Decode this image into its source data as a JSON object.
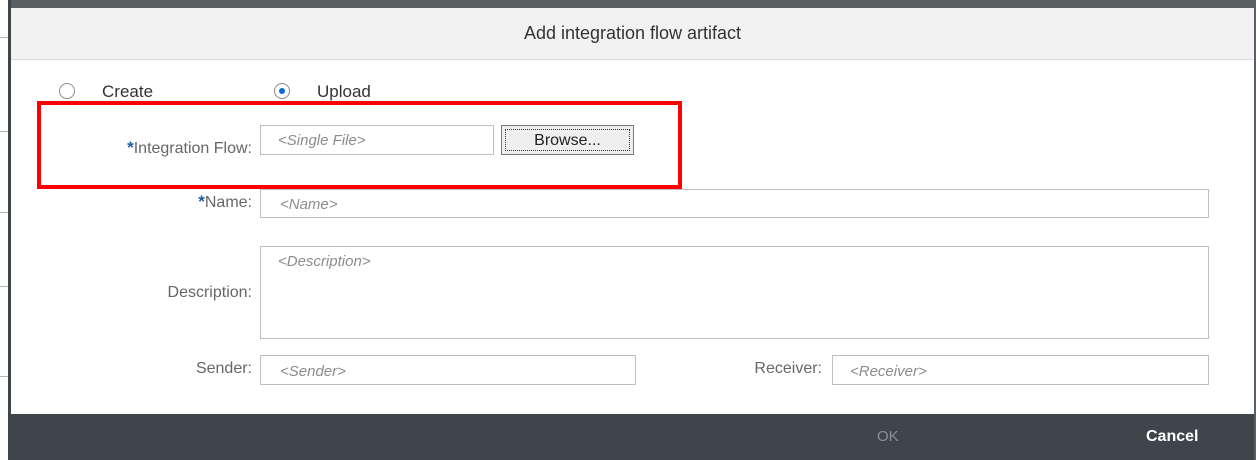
{
  "dialog": {
    "title": "Add integration flow artifact"
  },
  "mode": {
    "options": [
      {
        "label": "Create",
        "selected": false
      },
      {
        "label": "Upload",
        "selected": true
      }
    ]
  },
  "form": {
    "required_mark": "*",
    "integration_flow": {
      "label": "Integration Flow:",
      "placeholder": "<Single File>",
      "browse_label": "Browse..."
    },
    "name": {
      "label": "Name:",
      "placeholder": "<Name>"
    },
    "description": {
      "label": "Description:",
      "placeholder": "<Description>"
    },
    "sender": {
      "label": "Sender:",
      "placeholder": "<Sender>"
    },
    "receiver": {
      "label": "Receiver:",
      "placeholder": "<Receiver>"
    }
  },
  "footer": {
    "ok_label": "OK",
    "cancel_label": "Cancel"
  },
  "colors": {
    "accent": "#0a6ed1",
    "required": "#1d5ba4",
    "annotation": "#ff0000",
    "footer_bg": "#3f4649"
  }
}
